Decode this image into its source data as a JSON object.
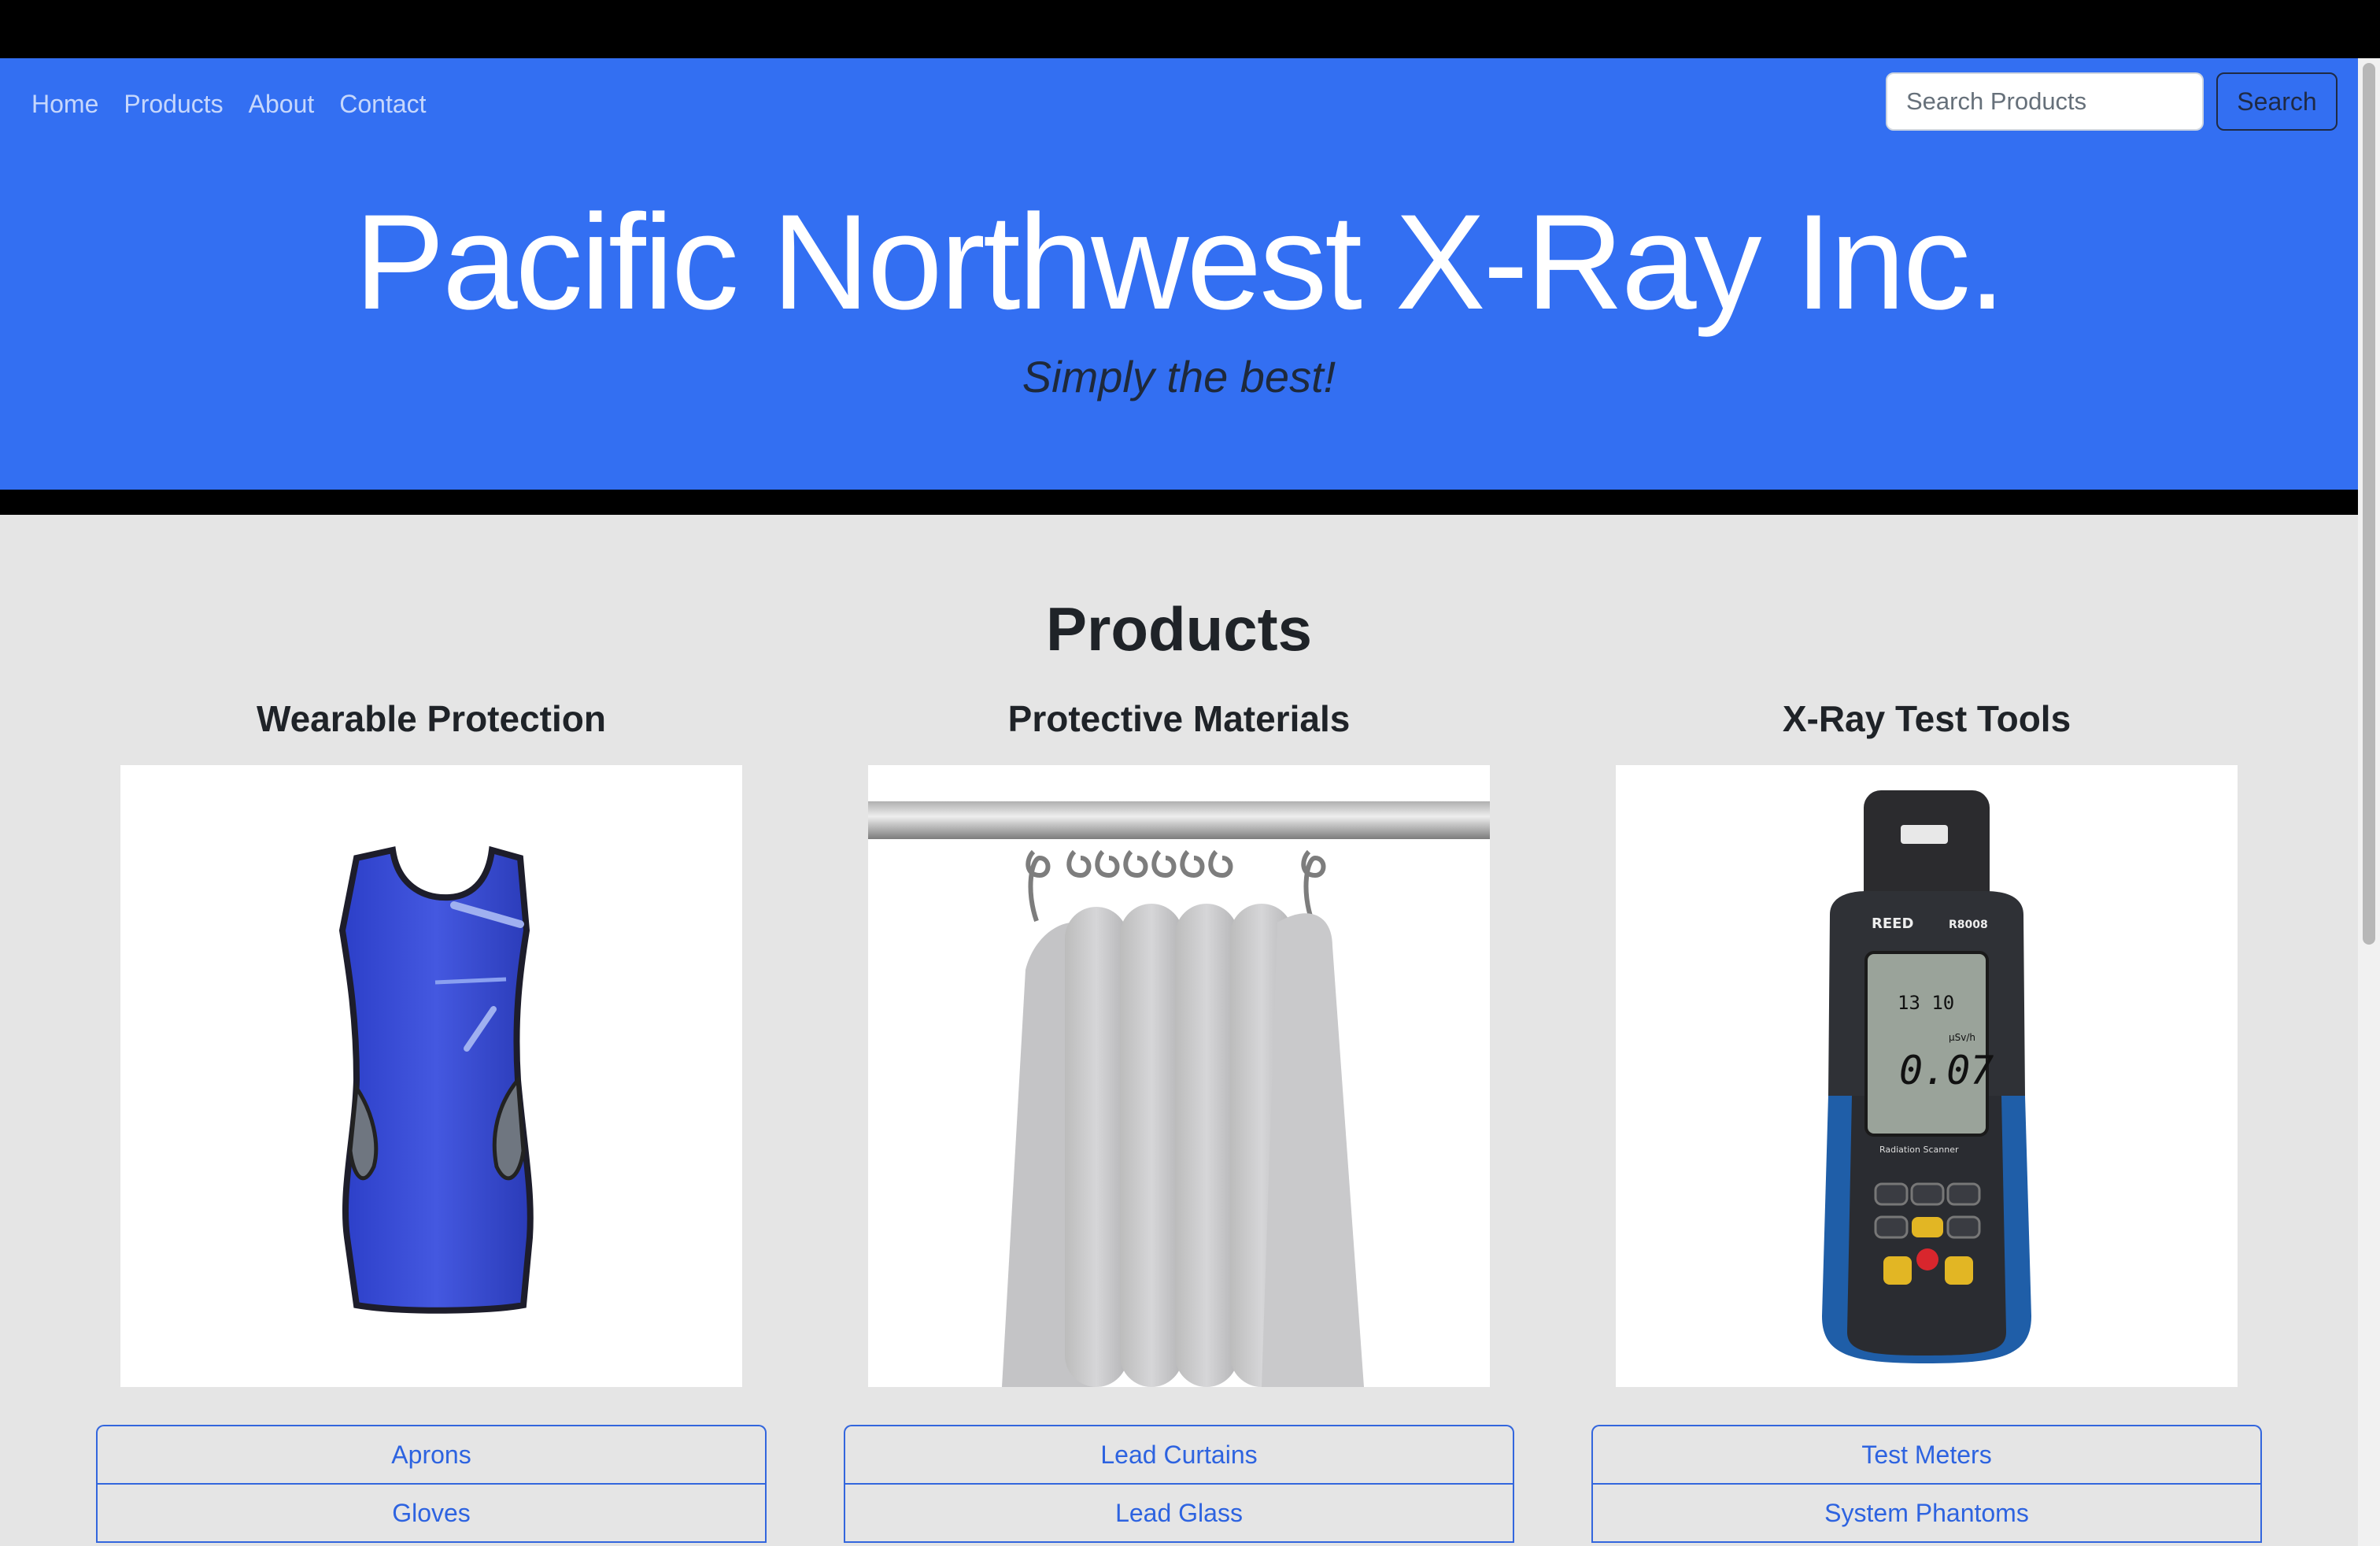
{
  "nav": {
    "links": [
      "Home",
      "Products",
      "About",
      "Contact"
    ]
  },
  "search": {
    "placeholder": "Search Products",
    "button_label": "Search"
  },
  "hero": {
    "title": "Pacific Northwest X-Ray Inc.",
    "tagline": "Simply the best!"
  },
  "products": {
    "title": "Products",
    "categories": [
      {
        "title": "Wearable Protection",
        "image_icon": "lead-apron-icon",
        "items": [
          "Aprons",
          "Gloves"
        ]
      },
      {
        "title": "Protective Materials",
        "image_icon": "lead-curtain-icon",
        "items": [
          "Lead Curtains",
          "Lead Glass"
        ]
      },
      {
        "title": "X-Ray Test Tools",
        "image_icon": "radiation-meter-icon",
        "meter_brand": "REED",
        "meter_model": "R8008",
        "meter_reading": "0.07",
        "meter_time": "13 10",
        "meter_unit": "μSv/h",
        "meter_label": "Radiation Scanner",
        "items": [
          "Test Meters",
          "System Phantoms"
        ]
      }
    ]
  },
  "colors": {
    "header_bg": "#336ff2",
    "main_bg": "#e5e5e5",
    "link": "#2d63e0"
  }
}
